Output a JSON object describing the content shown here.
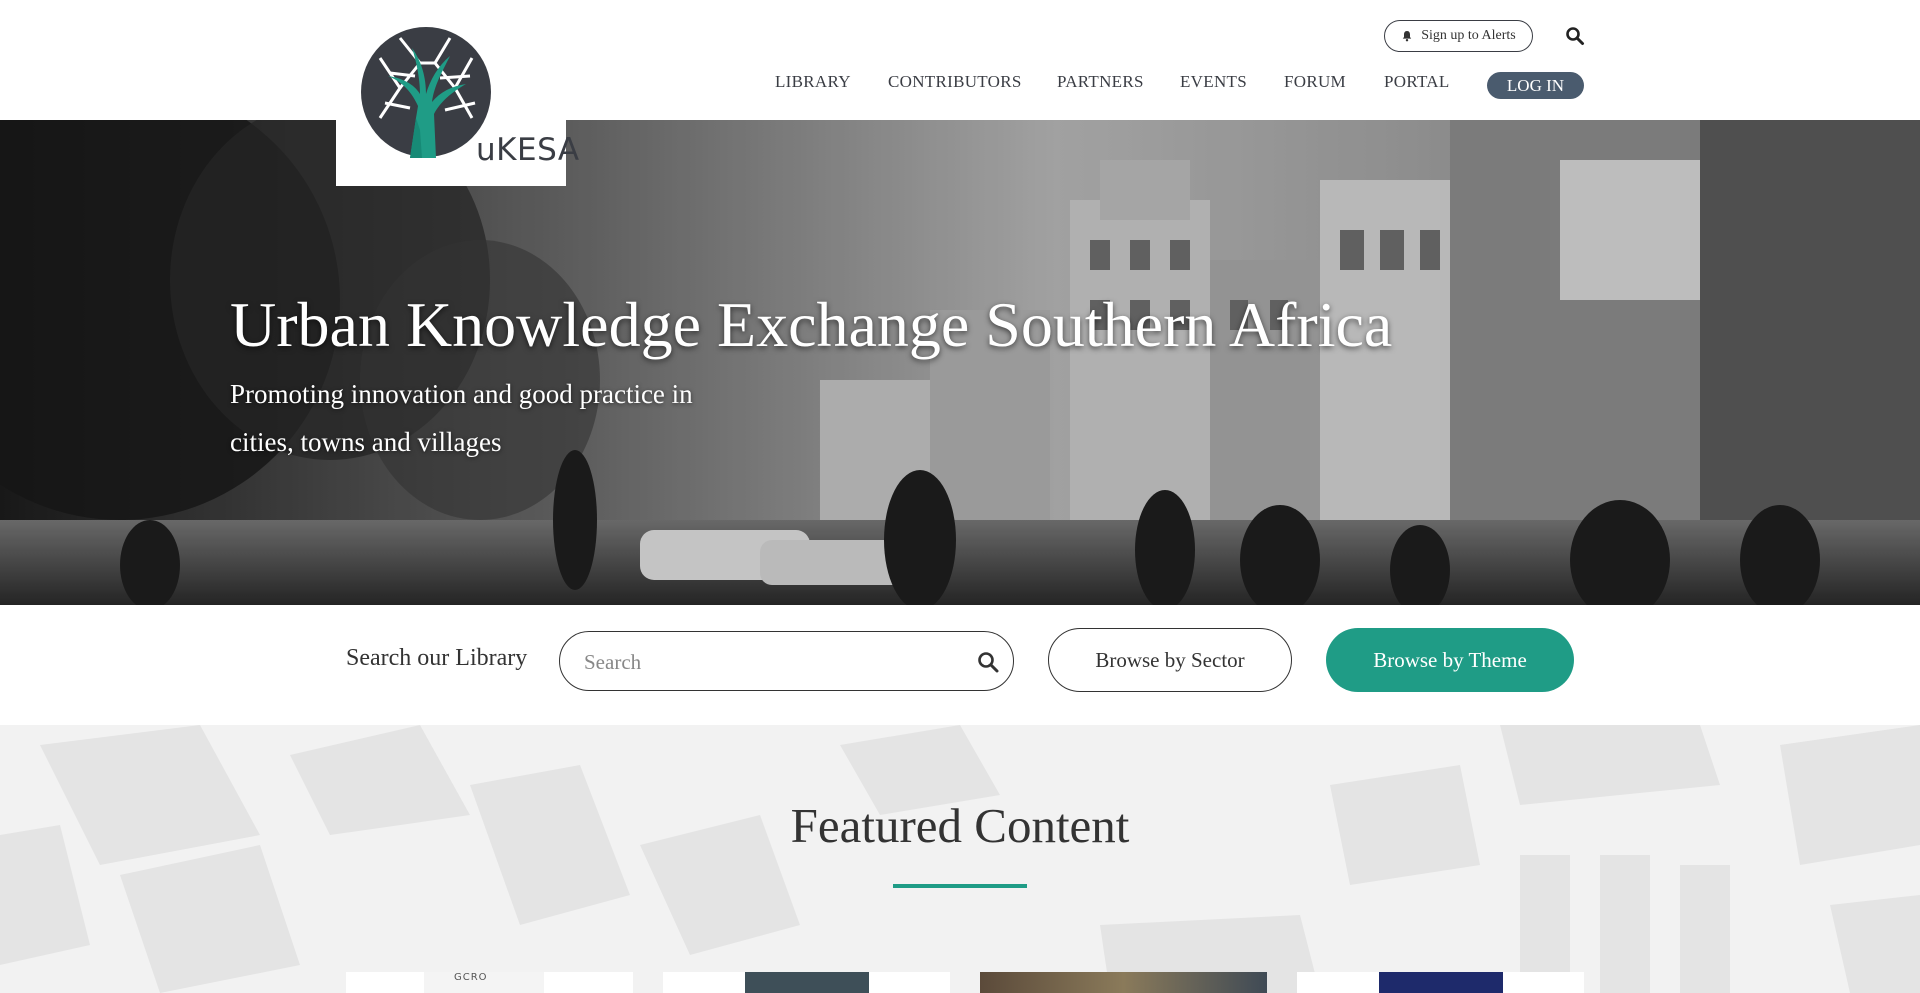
{
  "logo": {
    "text": "uKESA"
  },
  "header": {
    "alerts_label": "Sign up to Alerts",
    "nav": [
      "LIBRARY",
      "CONTRIBUTORS",
      "PARTNERS",
      "EVENTS",
      "FORUM",
      "PORTAL"
    ],
    "login_label": "LOG IN"
  },
  "hero": {
    "title": "Urban Knowledge Exchange Southern Africa",
    "subtitle": "Promoting innovation and good practice in cities, towns and villages"
  },
  "search": {
    "label": "Search our Library",
    "placeholder": "Search",
    "browse_sector": "Browse by Sector",
    "browse_theme": "Browse by Theme"
  },
  "featured": {
    "title": "Featured Content",
    "cards": [
      {
        "thumb_text": "GCRO"
      },
      {
        "thumb_text": ""
      },
      {
        "thumb_text": ""
      },
      {
        "thumb_text": ""
      }
    ]
  },
  "colors": {
    "accent": "#1f9c86",
    "nav_text": "#3a3d44",
    "login_bg": "#4a5b6e"
  }
}
